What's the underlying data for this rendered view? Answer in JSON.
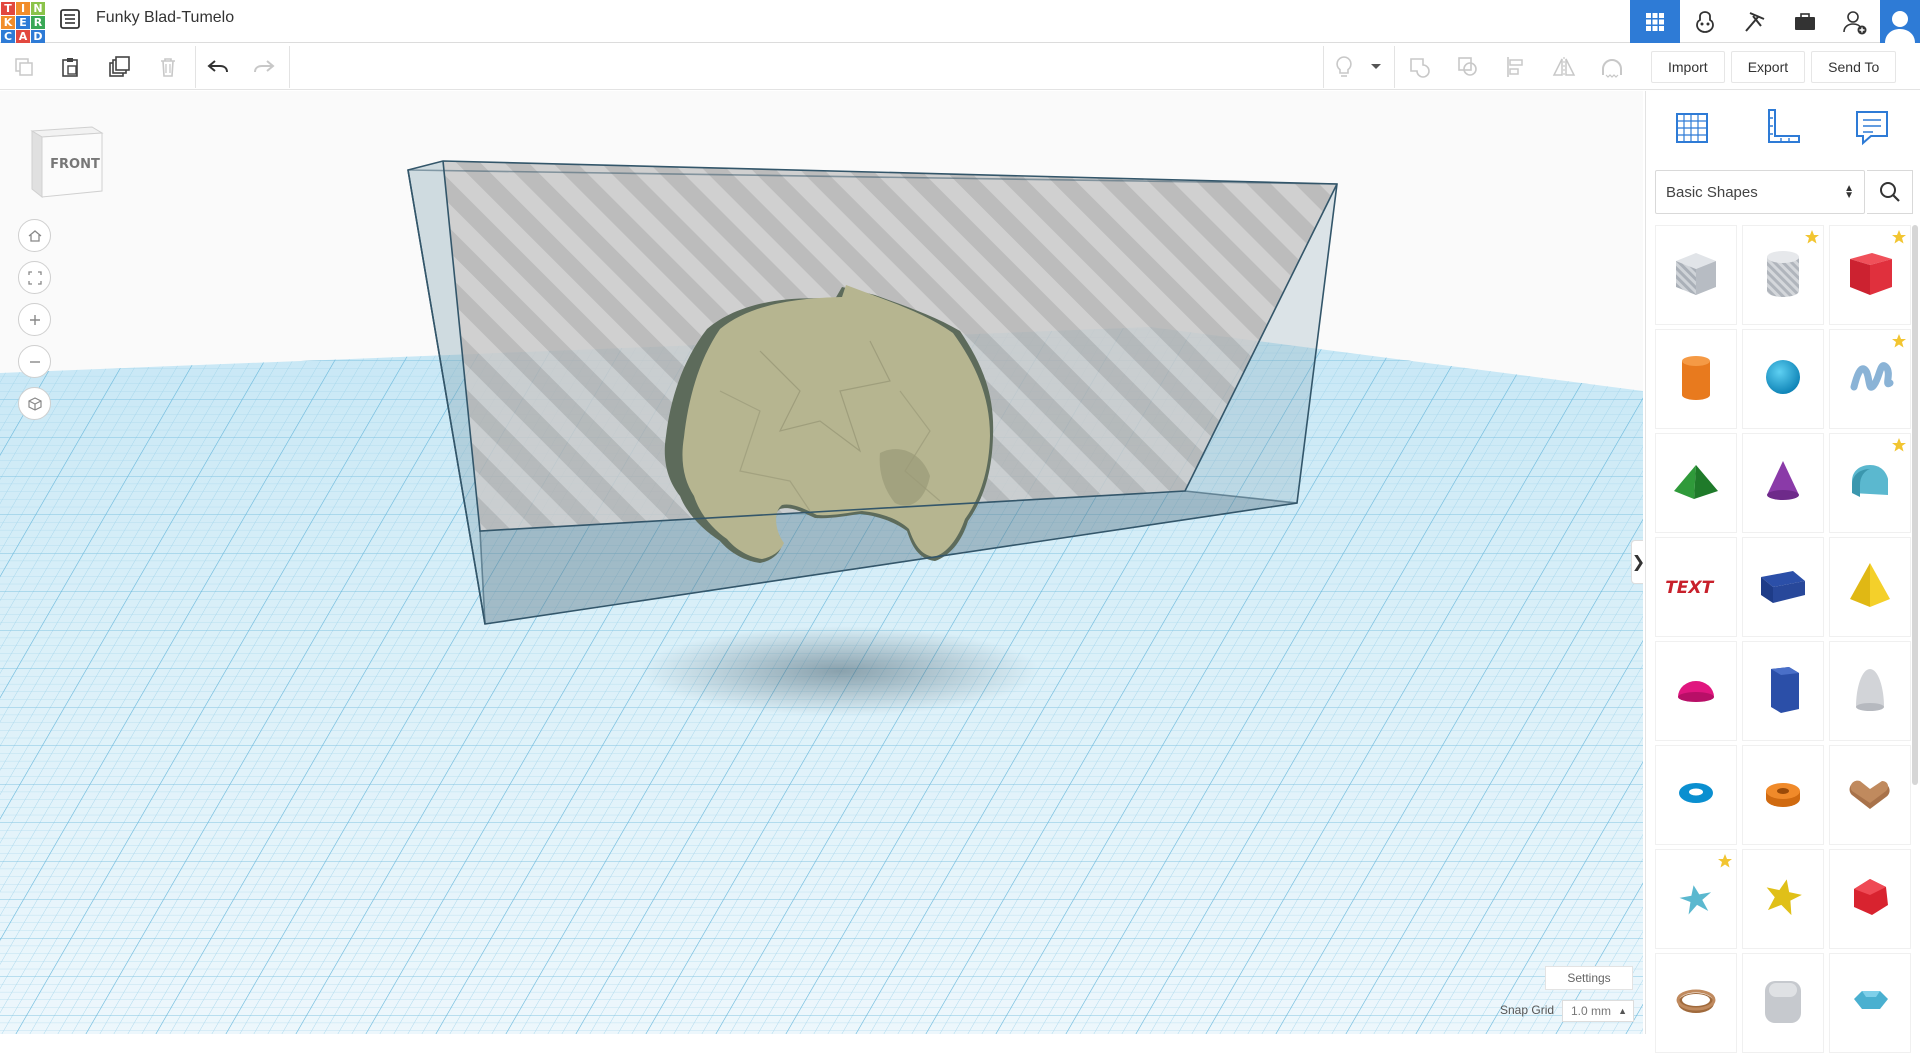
{
  "app": {
    "title": "Funky Blad-Tumelo",
    "logo_letters": [
      "T",
      "I",
      "N",
      "K",
      "E",
      "R",
      "C",
      "A",
      "D"
    ],
    "logo_colors": [
      "#e2483f",
      "#f18d2b",
      "#8bc34a",
      "#f18d2b",
      "#2e7bd6",
      "#3aa856",
      "#2e7bd6",
      "#e2483f",
      "#2e7bd6"
    ]
  },
  "topbar": {
    "icons": [
      "grid-view-icon",
      "blocks-icon",
      "bricks-icon",
      "briefcase-icon",
      "add-user-icon"
    ]
  },
  "toolbar": {
    "icons": [
      "copy-icon",
      "paste-icon",
      "duplicate-icon",
      "delete-icon",
      "undo-icon",
      "redo-icon",
      "light-bulb-icon",
      "dropdown-icon",
      "group-icon",
      "ungroup-icon",
      "align-icon",
      "mirror-icon",
      "magnet-icon"
    ]
  },
  "actions": {
    "import_label": "Import",
    "export_label": "Export",
    "send_to_label": "Send To"
  },
  "viewport": {
    "viewcube_label": "FRONT",
    "settings_label": "Settings",
    "snap_grid_label": "Snap Grid",
    "snap_grid_value": "1.0 mm",
    "collapse_glyph": "❯"
  },
  "panel": {
    "library_selected": "Basic Shapes",
    "tabs": [
      "workplane-icon",
      "ruler-icon",
      "notes-icon"
    ],
    "shapes": [
      {
        "name": "box-hole",
        "favorite": false
      },
      {
        "name": "cylinder-hole",
        "favorite": true
      },
      {
        "name": "box",
        "favorite": true
      },
      {
        "name": "cylinder",
        "favorite": false
      },
      {
        "name": "sphere",
        "favorite": false
      },
      {
        "name": "scribble",
        "favorite": true
      },
      {
        "name": "roof",
        "favorite": false
      },
      {
        "name": "cone",
        "favorite": false
      },
      {
        "name": "round-roof",
        "favorite": true
      },
      {
        "name": "text",
        "favorite": false
      },
      {
        "name": "wedge",
        "favorite": false
      },
      {
        "name": "pyramid",
        "favorite": false
      },
      {
        "name": "half-sphere",
        "favorite": false
      },
      {
        "name": "polygon",
        "favorite": false
      },
      {
        "name": "paraboloid",
        "favorite": false
      },
      {
        "name": "torus",
        "favorite": false
      },
      {
        "name": "tube",
        "favorite": false
      },
      {
        "name": "heart",
        "favorite": false
      },
      {
        "name": "star",
        "favorite": true
      },
      {
        "name": "star-yellow",
        "favorite": false
      },
      {
        "name": "icosahedron",
        "favorite": false
      },
      {
        "name": "ring",
        "favorite": false
      },
      {
        "name": "rounded-box-hole",
        "favorite": false
      },
      {
        "name": "gem",
        "favorite": false
      }
    ],
    "text_shape_label": "TEXT"
  }
}
